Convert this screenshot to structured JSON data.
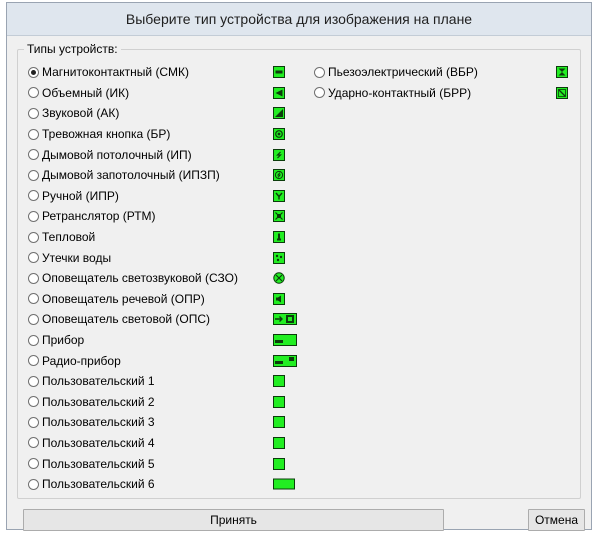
{
  "window": {
    "title": "Выберите тип устройства для изображения на плане"
  },
  "group": {
    "legend": "Типы устройств:"
  },
  "left_options": [
    {
      "label": "Магнитоконтактный (СМК)",
      "checked": true,
      "icon": "smk-icon"
    },
    {
      "label": "Объемный (ИК)",
      "checked": false,
      "icon": "ik-icon"
    },
    {
      "label": "Звуковой (АК)",
      "checked": false,
      "icon": "ak-icon"
    },
    {
      "label": "Тревожная кнопка (БР)",
      "checked": false,
      "icon": "br-icon"
    },
    {
      "label": "Дымовой потолочный (ИП)",
      "checked": false,
      "icon": "ip-icon"
    },
    {
      "label": "Дымовой запотолочный (ИПЗП)",
      "checked": false,
      "icon": "ipzp-icon"
    },
    {
      "label": "Ручной (ИПР)",
      "checked": false,
      "icon": "ipr-icon"
    },
    {
      "label": "Ретранслятор (РТМ)",
      "checked": false,
      "icon": "rtm-icon"
    },
    {
      "label": "Тепловой",
      "checked": false,
      "icon": "heat-icon"
    },
    {
      "label": "Утечки воды",
      "checked": false,
      "icon": "water-leak-icon"
    },
    {
      "label": "Оповещатель светозвуковой (СЗО)",
      "checked": false,
      "icon": "szo-icon"
    },
    {
      "label": "Оповещатель речевой (ОПР)",
      "checked": false,
      "icon": "opr-icon"
    },
    {
      "label": "Оповещатель световой (ОПС)",
      "checked": false,
      "icon": "ops-icon"
    },
    {
      "label": "Прибор",
      "checked": false,
      "icon": "device-icon"
    },
    {
      "label": "Радио-прибор",
      "checked": false,
      "icon": "radio-device-icon"
    },
    {
      "label": "Пользовательский 1",
      "checked": false,
      "icon": "custom-1-icon"
    },
    {
      "label": "Пользовательский 2",
      "checked": false,
      "icon": "custom-2-icon"
    },
    {
      "label": "Пользовательский 3",
      "checked": false,
      "icon": "custom-3-icon"
    },
    {
      "label": "Пользовательский 4",
      "checked": false,
      "icon": "custom-4-icon"
    },
    {
      "label": "Пользовательский 5",
      "checked": false,
      "icon": "custom-5-icon"
    },
    {
      "label": "Пользовательский 6",
      "checked": false,
      "icon": "custom-6-icon"
    }
  ],
  "right_options": [
    {
      "label": "Пьезоэлектрический (ВБР)",
      "checked": false,
      "icon": "vbr-icon"
    },
    {
      "label": "Ударно-контактный (БРР)",
      "checked": false,
      "icon": "brr-icon"
    }
  ],
  "buttons": {
    "accept": "Принять",
    "cancel": "Отмена"
  },
  "colors": {
    "icon_fill": "#22ee22",
    "icon_border": "#0c3c0c"
  }
}
